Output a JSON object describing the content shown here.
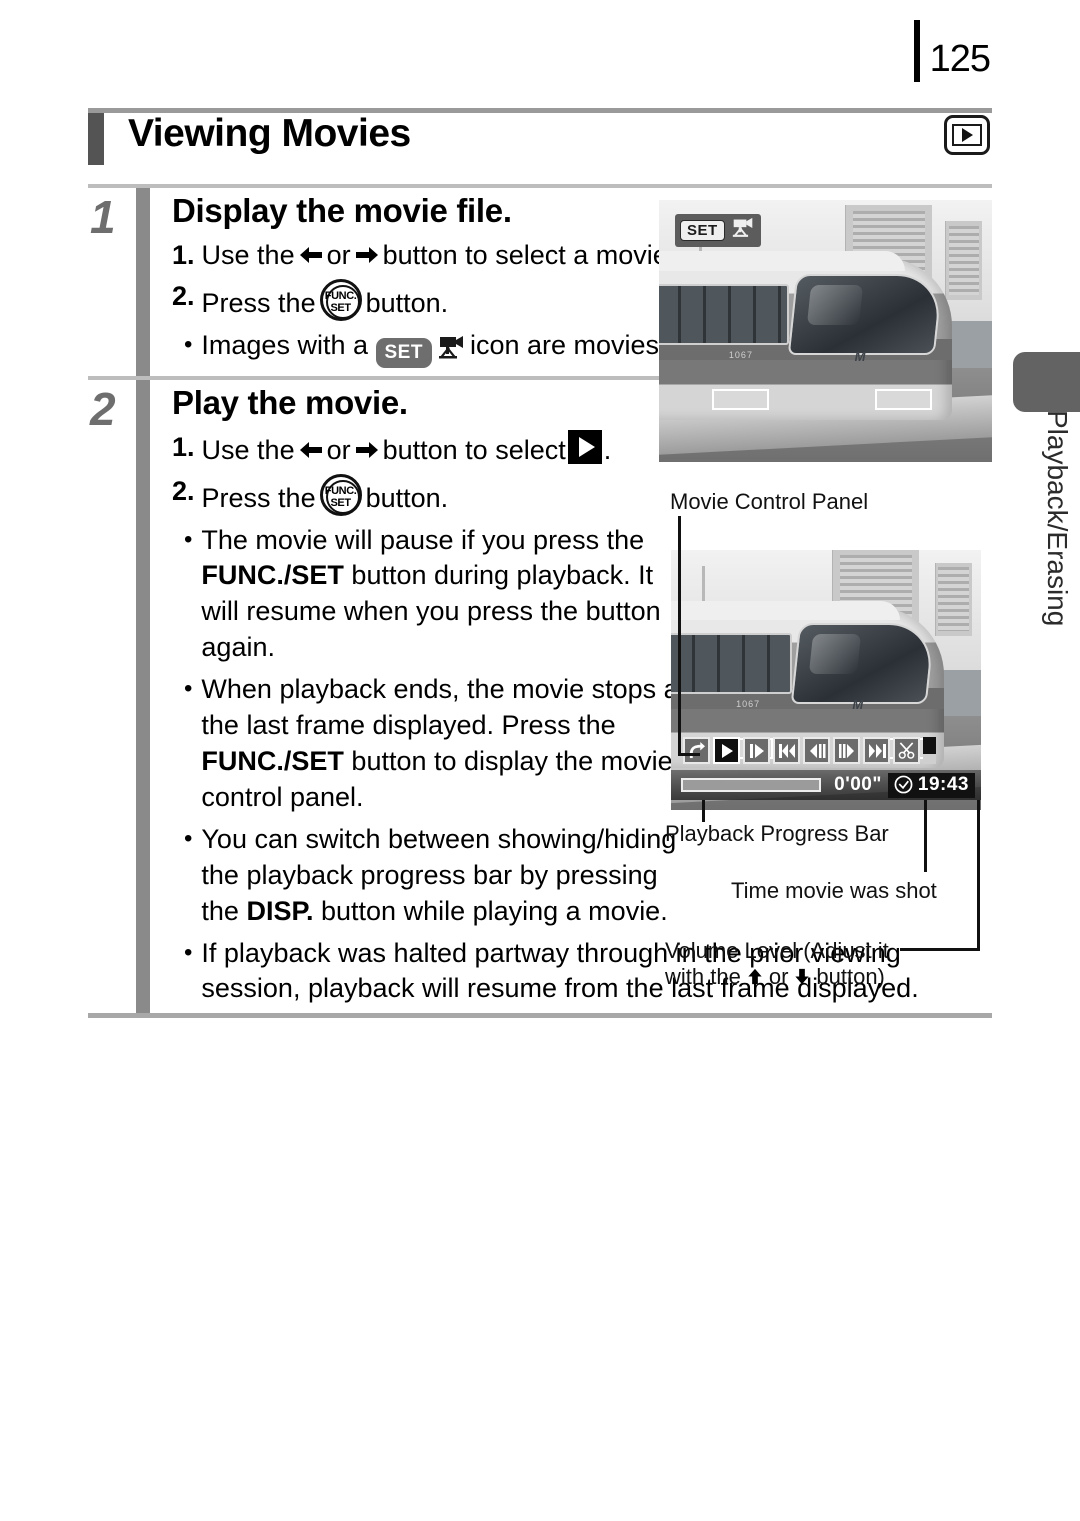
{
  "page": {
    "number": "125"
  },
  "header": {
    "title": "Viewing Movies",
    "mode_icon": "playback-mode-icon"
  },
  "side_tab": {
    "label": "Playback/Erasing"
  },
  "steps": [
    {
      "number": "1",
      "heading": "Display the movie file.",
      "substeps": [
        {
          "marker": "1.",
          "text_before": "Use the",
          "text_mid": "or",
          "text_after": "button to select a movie."
        },
        {
          "marker": "2.",
          "text_before": "Press the",
          "text_after": "button."
        }
      ],
      "bullets": [
        {
          "text_before": "Images with a",
          "text_after": "icon are movies."
        }
      ]
    },
    {
      "number": "2",
      "heading": "Play the movie.",
      "substeps": [
        {
          "marker": "1.",
          "text_before": "Use the",
          "text_mid": "or",
          "text_after": "button to select",
          "trailing": "."
        },
        {
          "marker": "2.",
          "text_before": "Press the",
          "text_after": "button."
        }
      ],
      "bullets": [
        {
          "segments": [
            {
              "t": "The movie will pause if you press the "
            },
            {
              "t": "FUNC./SET",
              "b": true
            },
            {
              "t": " button during playback. It will resume when you press the button again."
            }
          ]
        },
        {
          "segments": [
            {
              "t": "When playback ends, the movie stops at the last frame displayed. Press the "
            },
            {
              "t": "FUNC./SET",
              "b": true
            },
            {
              "t": " button to display the movie control panel."
            }
          ]
        },
        {
          "segments": [
            {
              "t": "You can switch between showing/hiding the playback progress bar by pressing the "
            },
            {
              "t": "DISP.",
              "b": true
            },
            {
              "t": " button while playing a movie."
            }
          ]
        },
        {
          "segments": [
            {
              "t": "If playback was halted partway through in the prior viewing session, playback will resume from the last frame displayed."
            }
          ]
        }
      ]
    }
  ],
  "screen": {
    "set_badge": {
      "label": "SET",
      "icon": "movie-camera-icon"
    },
    "control_panel": {
      "buttons": [
        {
          "name": "exit-button",
          "icon": "return-arrow-icon",
          "selected": false
        },
        {
          "name": "play-button",
          "icon": "play-icon",
          "selected": true
        },
        {
          "name": "slow-motion-button",
          "icon": "slow-motion-icon",
          "selected": false
        },
        {
          "name": "first-frame-button",
          "icon": "skip-back-icon",
          "selected": false
        },
        {
          "name": "previous-frame-button",
          "icon": "step-back-icon",
          "selected": false
        },
        {
          "name": "next-frame-button",
          "icon": "step-forward-icon",
          "selected": false
        },
        {
          "name": "last-frame-button",
          "icon": "skip-forward-icon",
          "selected": false
        },
        {
          "name": "edit-button",
          "icon": "scissors-icon",
          "selected": false
        }
      ],
      "volume_icon": "volume-level-indicator"
    },
    "elapsed_time": "0'00\"",
    "shot_time": "19:43",
    "clock_icon": "clock-icon"
  },
  "callouts": {
    "control_panel": "Movie Control Panel",
    "progress_bar": "Playback Progress Bar",
    "time_shot": "Time movie was shot",
    "volume_line1": "Volume Level (Adjust it",
    "volume_line2_before": "with the",
    "volume_line2_mid": "or",
    "volume_line2_after": "button)"
  },
  "colors": {
    "title_accent": "#545454",
    "gutter": "#8a8a8a",
    "step_number": "#6e6e6e",
    "rule": "#bdbdbd",
    "side_tab": "#636363"
  }
}
